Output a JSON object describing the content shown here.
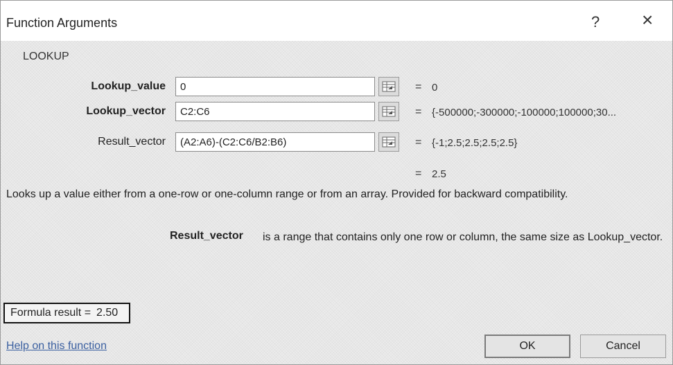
{
  "dialog": {
    "title": "Function Arguments",
    "help_glyph": "?",
    "close_glyph": "×",
    "function_name": "LOOKUP"
  },
  "args": [
    {
      "label": "Lookup_value",
      "value": "0",
      "equals": "=",
      "evaluated": "0",
      "bold": true
    },
    {
      "label": "Lookup_vector",
      "value": "C2:C6",
      "equals": "=",
      "evaluated": "{-500000;-300000;-100000;100000;30...",
      "bold": true
    },
    {
      "label": "Result_vector",
      "value": "(A2:A6)-(C2:C6/B2:B6)",
      "equals": "=",
      "evaluated": "{-1;2.5;2.5;2.5;2.5}",
      "bold": false
    }
  ],
  "result": {
    "equals": "=",
    "value": "2.5"
  },
  "description": "Looks up a value either from a one-row or one-column range or from an array. Provided for backward compatibility.",
  "argument_help": {
    "name": "Result_vector",
    "text": "is a range that contains only one row or column, the same size as Lookup_vector."
  },
  "formula_result": {
    "label": "Formula result =",
    "value": "2.50"
  },
  "help_link": "Help on this function",
  "buttons": {
    "ok": "OK",
    "cancel": "Cancel"
  },
  "icons": {
    "ref_button": "collapse-dialog-icon"
  }
}
